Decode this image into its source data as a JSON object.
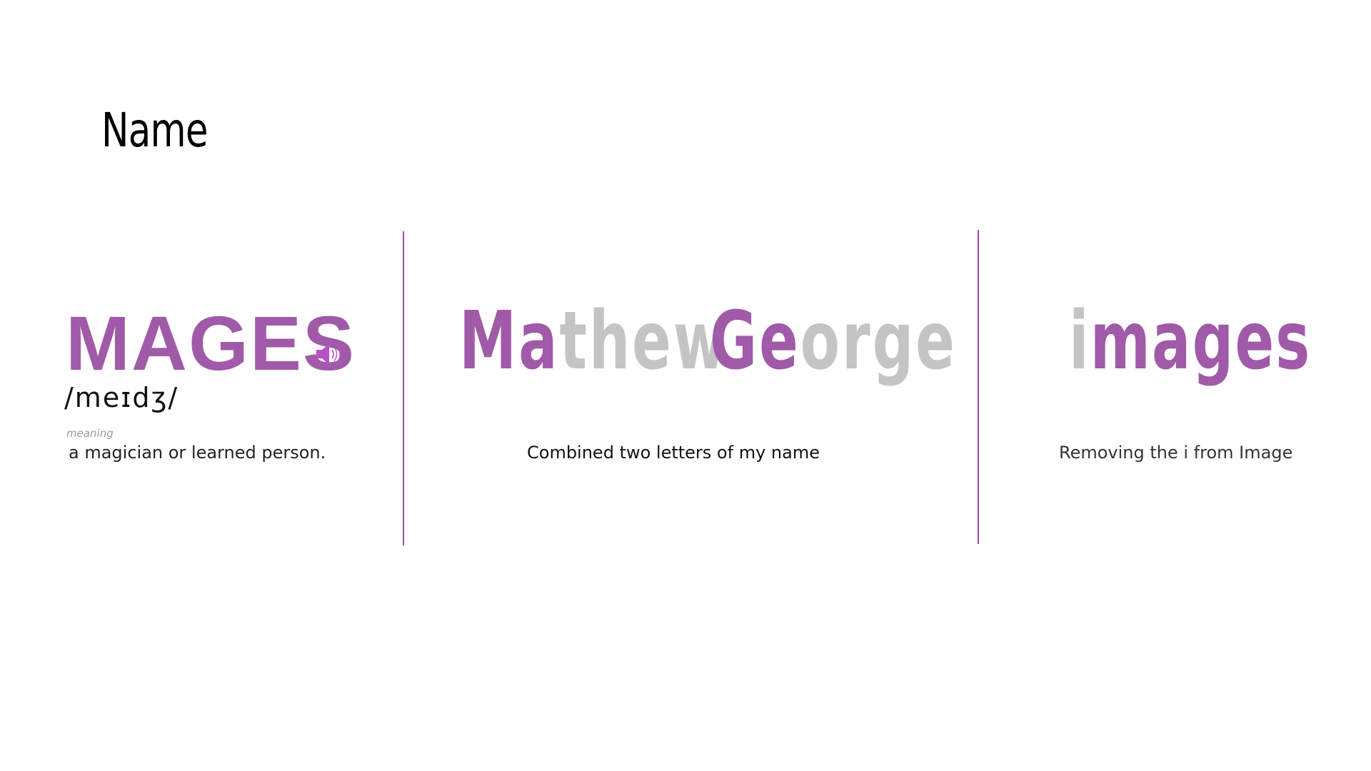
{
  "title": "Name",
  "colors": {
    "accent": "#a05aa8",
    "muted": "#c4c4c4",
    "divider": "#9b4da5",
    "speaker": "#b84fc6"
  },
  "left": {
    "word": "MAGES",
    "speaker_icon": "speaker-icon",
    "phonetic": "/meɪdʒ/",
    "meaning_label": "meaning",
    "meaning": "a magician or learned person."
  },
  "middle": {
    "first_name": {
      "highlight": "Ma",
      "rest": "thew"
    },
    "last_name": {
      "highlight": "Ge",
      "rest": "orge"
    },
    "caption": "Combined two letters of my name"
  },
  "right": {
    "removed_letter": "i",
    "rest": "mages",
    "caption": "Removing the i from Image"
  }
}
